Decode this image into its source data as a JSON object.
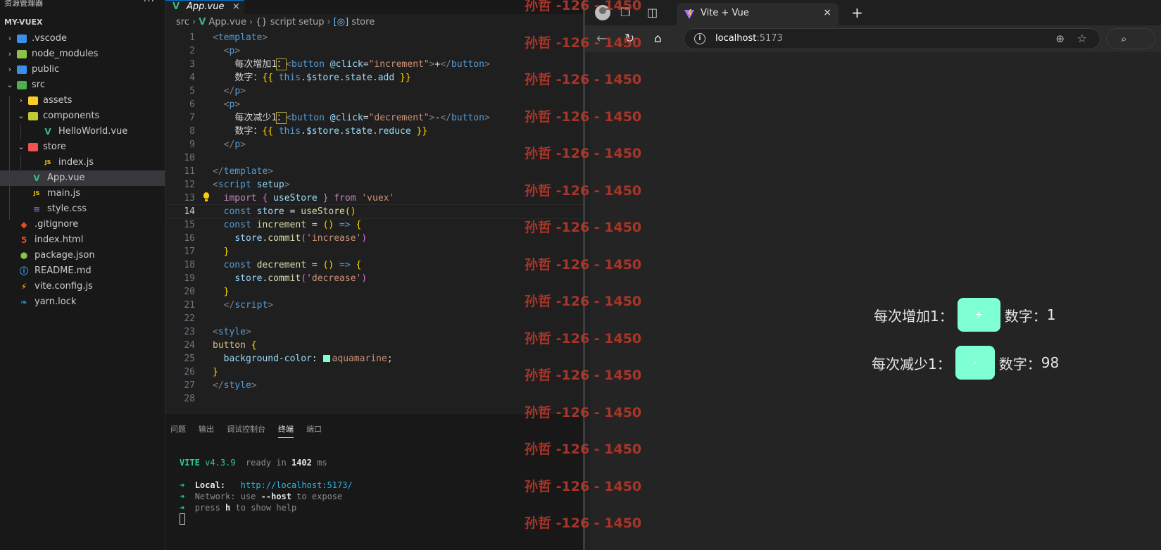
{
  "explorer": {
    "title": "资源管理器",
    "more": "···",
    "root": "MY-VUEX",
    "items": [
      {
        "label": ".vscode",
        "type": "folder",
        "icon_color": "#3b8eea"
      },
      {
        "label": "node_modules",
        "type": "folder",
        "icon_color": "#8bc34a"
      },
      {
        "label": "public",
        "type": "folder",
        "icon_color": "#3b8eea"
      },
      {
        "label": "src",
        "type": "folder",
        "icon_color": "#4caf50"
      },
      {
        "label": "assets",
        "type": "folder",
        "icon_color": "#ffca28"
      },
      {
        "label": "components",
        "type": "folder",
        "icon_color": "#c0ca33"
      },
      {
        "label": "HelloWorld.vue",
        "type": "vue"
      },
      {
        "label": "store",
        "type": "folder",
        "icon_color": "#ef5350"
      },
      {
        "label": "index.js",
        "type": "js"
      },
      {
        "label": "App.vue",
        "type": "vue"
      },
      {
        "label": "main.js",
        "type": "js"
      },
      {
        "label": "style.css",
        "type": "css"
      },
      {
        "label": ".gitignore",
        "type": "git"
      },
      {
        "label": "index.html",
        "type": "html"
      },
      {
        "label": "package.json",
        "type": "node"
      },
      {
        "label": "README.md",
        "type": "info"
      },
      {
        "label": "vite.config.js",
        "type": "vite"
      },
      {
        "label": "yarn.lock",
        "type": "yarn"
      }
    ]
  },
  "editor": {
    "tab_label": "App.vue",
    "tab_close": "×",
    "breadcrumb": {
      "src": "src",
      "file": "App.vue",
      "section": "{} script setup",
      "symbol": "store"
    },
    "current_line": 14
  },
  "panel": {
    "tabs": [
      "问题",
      "输出",
      "调试控制台",
      "终端",
      "端口"
    ],
    "active_tab": "终端",
    "vite_name": "VITE",
    "vite_version": "v4.3.9",
    "ready_text": "ready in",
    "ready_ms": "1402",
    "ms": "ms",
    "local_label": "Local:",
    "local_url": "http://localhost:5173/",
    "network_label": "Network:",
    "network_use": "use",
    "network_flag": "--host",
    "network_rest": "to expose",
    "help_press": "press",
    "help_key": "h",
    "help_rest": "to show help"
  },
  "watermark": {
    "text": "孙哲 -126 - 1450"
  },
  "browser": {
    "tab_title": "Vite + Vue",
    "tab_close": "×",
    "new_tab": "+",
    "url_host": "localhost",
    "url_port": ":5173",
    "app": {
      "increase_label": "每次增加1：",
      "increase_button": "+",
      "increase_number_label": "数字：",
      "increase_value": "1",
      "decrease_label": "每次减少1：",
      "decrease_button": "-",
      "decrease_number_label": "数字：",
      "decrease_value": "98",
      "button_color": "#7fffd4"
    }
  }
}
